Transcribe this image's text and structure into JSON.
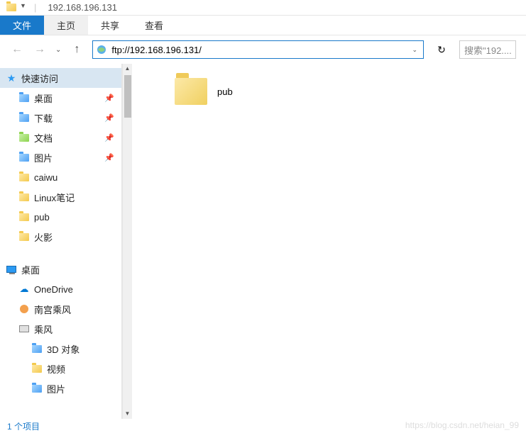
{
  "titlebar": {
    "text": "192.168.196.131"
  },
  "ribbon": {
    "file": "文件",
    "tabs": [
      "主页",
      "共享",
      "查看"
    ]
  },
  "nav": {
    "address": "ftp://192.168.196.131/",
    "search_placeholder": "搜索\"192...."
  },
  "sidebar": {
    "quick_access": {
      "label": "快速访问",
      "items": [
        {
          "label": "桌面",
          "icon": "folder-blue",
          "pinned": true
        },
        {
          "label": "下载",
          "icon": "folder-blue",
          "pinned": true
        },
        {
          "label": "文档",
          "icon": "folder-green",
          "pinned": true
        },
        {
          "label": "图片",
          "icon": "folder-blue",
          "pinned": true
        },
        {
          "label": "caiwu",
          "icon": "folder-yellow",
          "pinned": false
        },
        {
          "label": "Linux笔记",
          "icon": "folder-yellow",
          "pinned": false
        },
        {
          "label": "pub",
          "icon": "folder-yellow",
          "pinned": false
        },
        {
          "label": "火影",
          "icon": "folder-yellow",
          "pinned": false
        }
      ]
    },
    "desktop_section": {
      "label": "桌面",
      "items": [
        {
          "label": "OneDrive",
          "icon": "onedrive"
        },
        {
          "label": "南宫乘风",
          "icon": "user"
        },
        {
          "label": "乘风",
          "icon": "pc",
          "children": [
            {
              "label": "3D 对象",
              "icon": "folder-blue"
            },
            {
              "label": "视频",
              "icon": "folder-yellow"
            },
            {
              "label": "图片",
              "icon": "folder-blue"
            }
          ]
        }
      ]
    }
  },
  "content": {
    "items": [
      {
        "name": "pub",
        "type": "folder"
      }
    ]
  },
  "status": {
    "text": "1 个项目"
  },
  "watermark": "https://blog.csdn.net/heian_99"
}
